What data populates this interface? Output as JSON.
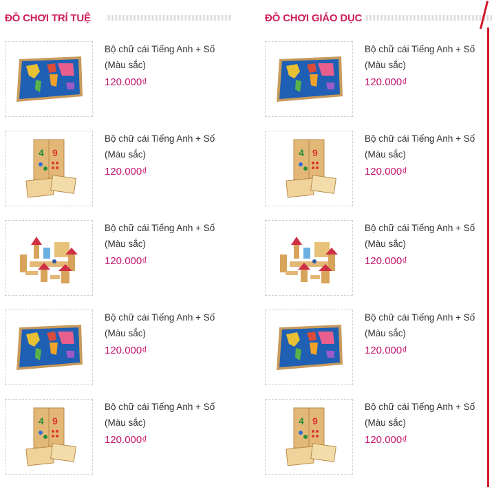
{
  "left_section": {
    "title": "ĐỒ CHƠI TRÍ TUỆ",
    "products": [
      {
        "name": "Bộ chữ cái Tiếng Anh + Số (Màu sắc)",
        "price": "120.000₫",
        "image": "world-map-puzzle"
      },
      {
        "name": "Bộ chữ cái Tiếng Anh + Số (Màu sắc)",
        "price": "120.000₫",
        "image": "wooden-number-box"
      },
      {
        "name": "Bộ chữ cái Tiếng Anh + Số (Màu sắc)",
        "price": "120.000₫",
        "image": "wooden-castle-blocks"
      },
      {
        "name": "Bộ chữ cái Tiếng Anh + Số (Màu sắc)",
        "price": "120.000₫",
        "image": "world-map-puzzle"
      },
      {
        "name": "Bộ chữ cái Tiếng Anh + Số (Màu sắc)",
        "price": "120.000₫",
        "image": "wooden-number-box"
      }
    ]
  },
  "right_section": {
    "title": "ĐỒ CHƠI GIÁO DỤC",
    "products": [
      {
        "name": "Bộ chữ cái Tiếng Anh + Số (Màu sắc)",
        "price": "120.000₫",
        "image": "world-map-puzzle"
      },
      {
        "name": "Bộ chữ cái Tiếng Anh + Số (Màu sắc)",
        "price": "120.000₫",
        "image": "wooden-number-box"
      },
      {
        "name": "Bộ chữ cái Tiếng Anh + Số (Màu sắc)",
        "price": "120.000₫",
        "image": "wooden-castle-blocks"
      },
      {
        "name": "Bộ chữ cái Tiếng Anh + Số (Màu sắc)",
        "price": "120.000₫",
        "image": "world-map-puzzle"
      },
      {
        "name": "Bộ chữ cái Tiếng Anh + Số (Màu sắc)",
        "price": "120.000₫",
        "image": "wooden-number-box"
      }
    ]
  },
  "colors": {
    "title": "#cc1f5e",
    "price": "#c3166f",
    "accent_line": "#d31a2a"
  }
}
